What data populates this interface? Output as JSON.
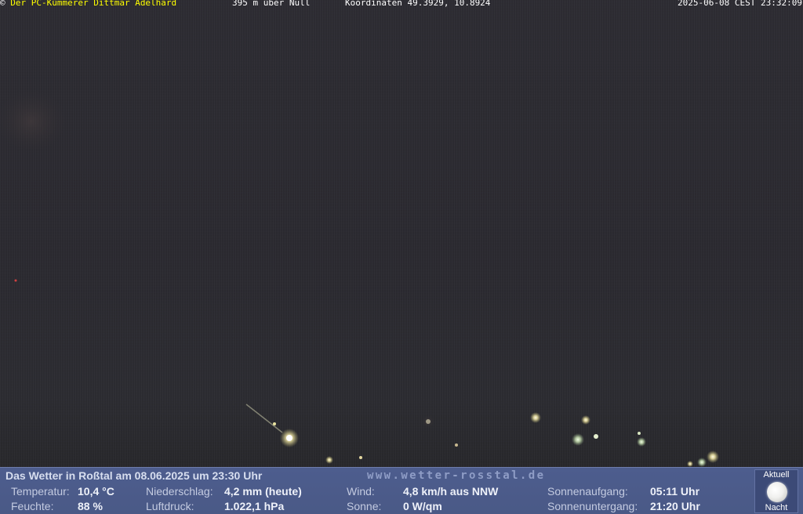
{
  "header": {
    "copyright_symbol": "©",
    "owner": "Der PC-Kümmerer Dittmar Adelhard",
    "altitude": "395 m über Null",
    "coordinates": "Koordinaten 49.3929, 10.8924",
    "timestamp": "2025-06-08 CEST 23:32:09"
  },
  "weather": {
    "title": "Das Wetter in Roßtal am 08.06.2025 um 23:30 Uhr",
    "website": "www.wetter-rosstal.de",
    "temperature": {
      "label": "Temperatur:",
      "value": "10,4 °C"
    },
    "humidity": {
      "label": "Feuchte:",
      "value": "88 %"
    },
    "precipitation": {
      "label": "Niederschlag:",
      "value": "4,2 mm (heute)"
    },
    "pressure": {
      "label": "Luftdruck:",
      "value": "1.022,1 hPa"
    },
    "wind": {
      "label": "Wind:",
      "value": "4,8 km/h aus NNW"
    },
    "sun_radiation": {
      "label": "Sonne:",
      "value": "0 W/qm"
    },
    "sunrise": {
      "label": "Sonnenaufgang:",
      "value": "05:11 Uhr"
    },
    "sunset": {
      "label": "Sonnenuntergang:",
      "value": "21:20 Uhr"
    }
  },
  "moon": {
    "top_label": "Aktuell",
    "bottom_label": "Nacht",
    "icon": "full-moon-icon"
  },
  "colors": {
    "header_owner": "#ffff00",
    "panel_background": "#4d5d8e",
    "sky": "#2a292f"
  }
}
